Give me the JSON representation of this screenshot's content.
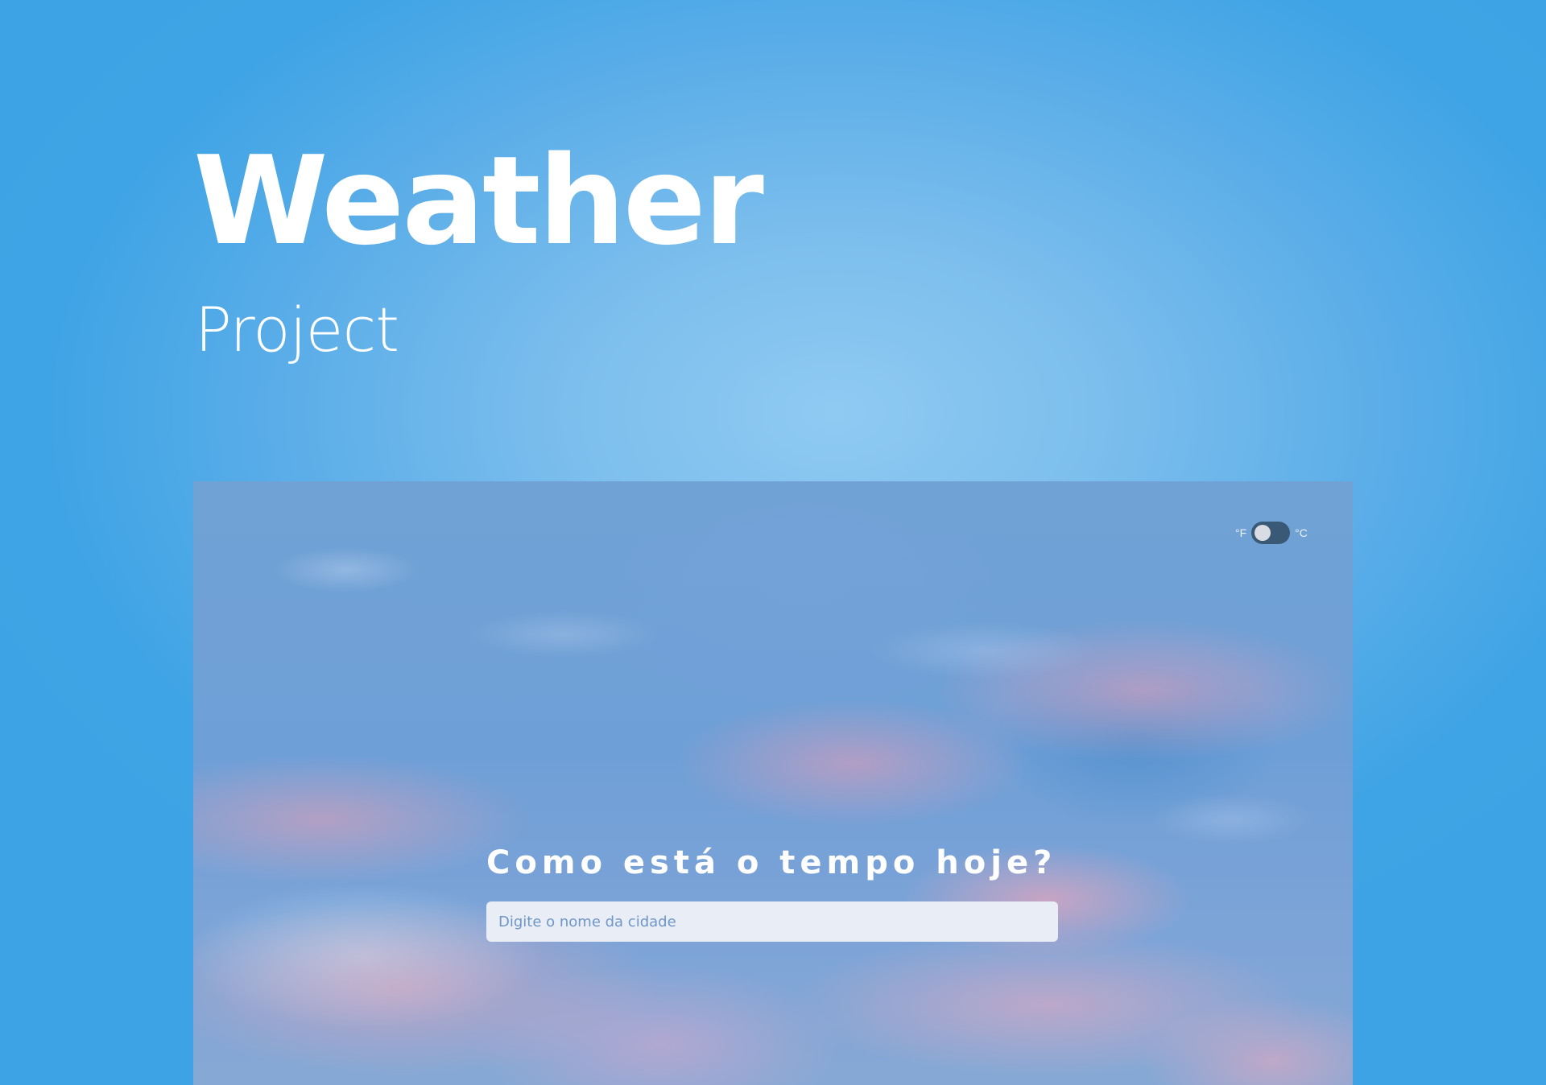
{
  "hero": {
    "title": "Weather",
    "subtitle": "Project"
  },
  "preview": {
    "unit_toggle": {
      "left_label": "°F",
      "right_label": "°C"
    },
    "heading": "Como está o tempo hoje?",
    "search": {
      "placeholder": "Digite o nome da cidade"
    }
  },
  "colors": {
    "page_background": "#3ea3e4",
    "text": "#ffffff",
    "toggle_track": "#395977",
    "toggle_knob": "#d9dde3",
    "input_background": "#e9edf5"
  }
}
